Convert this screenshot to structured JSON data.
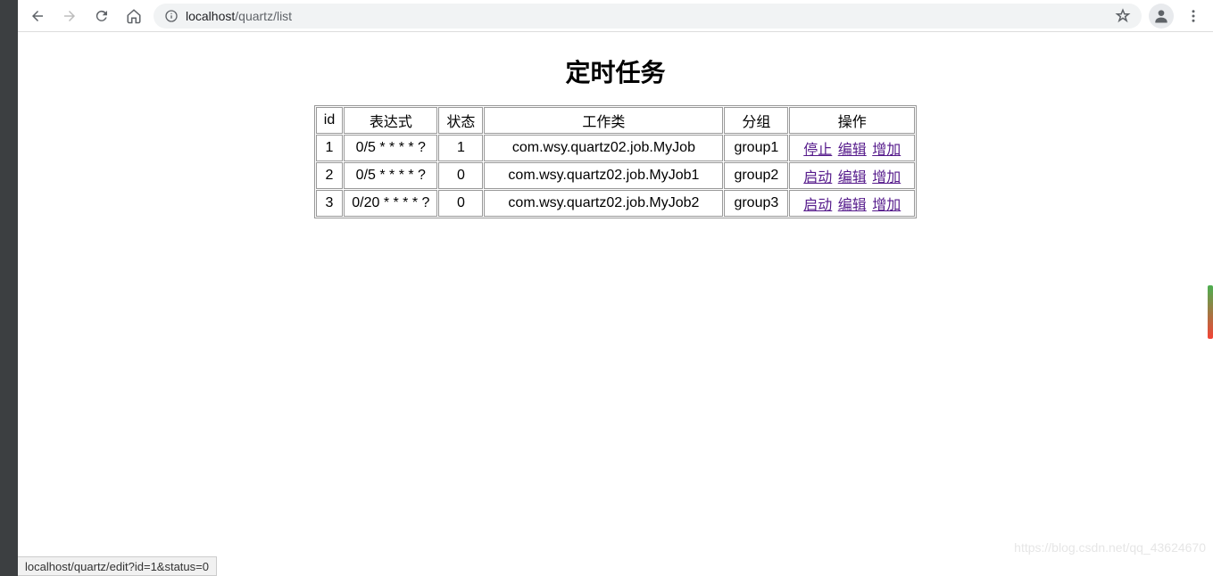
{
  "browser": {
    "url_host": "localhost",
    "url_path": "/quartz/list"
  },
  "page": {
    "title": "定时任务"
  },
  "table": {
    "headers": {
      "id": "id",
      "expr": "表达式",
      "status": "状态",
      "job": "工作类",
      "group": "分组",
      "ops": "操作"
    },
    "rows": [
      {
        "id": "1",
        "expr": "0/5 * * * * ?",
        "status": "1",
        "job": "com.wsy.quartz02.job.MyJob",
        "group": "group1",
        "toggle": "停止",
        "edit": "编辑",
        "add": "增加"
      },
      {
        "id": "2",
        "expr": "0/5 * * * * ?",
        "status": "0",
        "job": "com.wsy.quartz02.job.MyJob1",
        "group": "group2",
        "toggle": "启动",
        "edit": "编辑",
        "add": "增加"
      },
      {
        "id": "3",
        "expr": "0/20 * * * * ?",
        "status": "0",
        "job": "com.wsy.quartz02.job.MyJob2",
        "group": "group3",
        "toggle": "启动",
        "edit": "编辑",
        "add": "增加"
      }
    ]
  },
  "status_bar": {
    "text": "localhost/quartz/edit?id=1&status=0"
  },
  "watermark": "https://blog.csdn.net/qq_43624670"
}
